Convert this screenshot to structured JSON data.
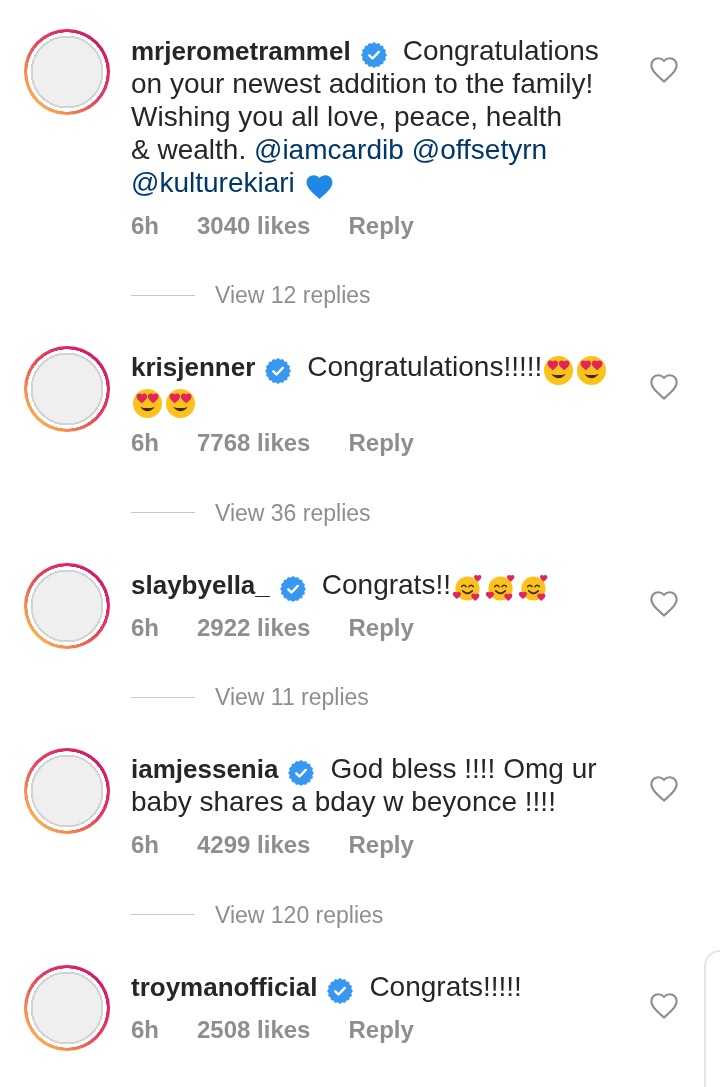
{
  "comments": [
    {
      "username": "mrjerometrammel",
      "verified": true,
      "segments": [
        {
          "kind": "text",
          "text": "Congratulations on your newest addition to the family! Wishing you all love, peace, health\n& wealth. "
        },
        {
          "kind": "mention",
          "text": "@iamcardib"
        },
        {
          "kind": "mention",
          "text": "@offsetyrn"
        },
        {
          "kind": "mention",
          "text": "@kulturekiari"
        },
        {
          "kind": "emoji_blue_heart"
        }
      ],
      "time": "6h",
      "likes": "3040 likes",
      "reply": "Reply",
      "view_replies": "View 12 replies",
      "liked": false
    },
    {
      "username": "krisjenner",
      "verified": true,
      "segments": [
        {
          "kind": "text",
          "text": "Congratulations!!!!!"
        },
        {
          "kind": "emoji_heart_eyes"
        },
        {
          "kind": "emoji_heart_eyes"
        },
        {
          "kind": "emoji_heart_eyes"
        },
        {
          "kind": "emoji_heart_eyes"
        }
      ],
      "time": "6h",
      "likes": "7768 likes",
      "reply": "Reply",
      "view_replies": "View 36 replies",
      "liked": false
    },
    {
      "username": "slaybyella_",
      "verified": true,
      "segments": [
        {
          "kind": "text",
          "text": "Congrats!!"
        },
        {
          "kind": "emoji_smiling_hearts"
        },
        {
          "kind": "emoji_smiling_hearts"
        },
        {
          "kind": "emoji_smiling_hearts"
        }
      ],
      "time": "6h",
      "likes": "2922 likes",
      "reply": "Reply",
      "view_replies": "View 11 replies",
      "liked": false
    },
    {
      "username": "iamjessenia",
      "verified": true,
      "segments": [
        {
          "kind": "text",
          "text": "God bless !!!! Omg ur baby shares a bday w beyonce !!!!"
        }
      ],
      "time": "6h",
      "likes": "4299 likes",
      "reply": "Reply",
      "view_replies": "View 120 replies",
      "liked": false
    },
    {
      "username": "troymanofficial",
      "verified": true,
      "segments": [
        {
          "kind": "text",
          "text": "Congrats!!!!!"
        }
      ],
      "time": "6h",
      "likes": "2508 likes",
      "reply": "Reply",
      "liked": false
    }
  ]
}
